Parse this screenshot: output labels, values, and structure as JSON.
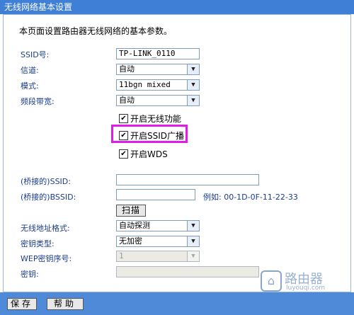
{
  "title": "无线网络基本设置",
  "description": "本页面设置路由器无线网络的基本参数。",
  "fields": {
    "ssid": {
      "label": "SSID号:",
      "value": "TP-LINK_0110"
    },
    "channel": {
      "label": "信道:",
      "value": "自动"
    },
    "mode": {
      "label": "模式:",
      "value": "11bgn mixed"
    },
    "bandwidth": {
      "label": "频段带宽:",
      "value": "自动"
    }
  },
  "checkboxes": {
    "enable_wireless": {
      "label": "开启无线功能",
      "checked": true
    },
    "ssid_broadcast": {
      "label": "开启SSID广播",
      "checked": true
    },
    "wds": {
      "label": "开启WDS",
      "checked": true
    }
  },
  "wds": {
    "bridged_ssid": {
      "label": "(桥接的)SSID:",
      "value": ""
    },
    "bridged_bssid": {
      "label": "(桥接的)BSSID:",
      "value": "",
      "example": "例如: 00-1D-0F-11-22-33"
    },
    "scan_button": "扫描",
    "mac_format": {
      "label": "无线地址格式:",
      "value": "自动探测"
    },
    "key_type": {
      "label": "密钥类型:",
      "value": "无加密"
    },
    "wep_index": {
      "label": "WEP密钥序号:",
      "value": "1"
    },
    "key": {
      "label": "密钥:",
      "value": ""
    }
  },
  "buttons": {
    "save": "保存",
    "help": "帮助"
  },
  "watermark": {
    "cn": "路由器",
    "en": "luyouqi.com"
  },
  "colors": {
    "titlebar": "#3f7fd6",
    "highlight": "#e21ce6",
    "footer": "#4f8ad8",
    "label": "#1a3c8a"
  }
}
